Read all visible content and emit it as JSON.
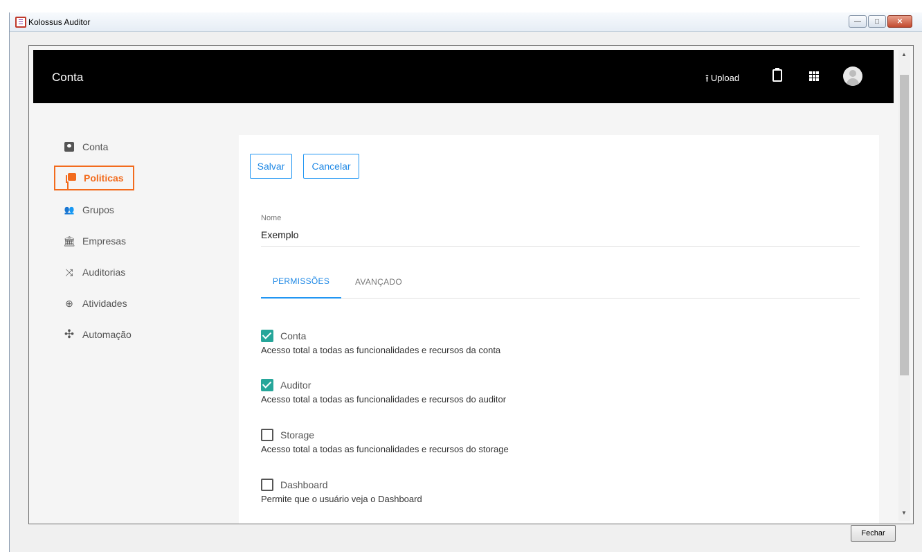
{
  "window": {
    "title": "Kolossus Auditor",
    "minimize_glyph": "—",
    "maximize_glyph": "□",
    "close_glyph": "✕"
  },
  "appbar": {
    "title": "Conta",
    "upload_label": "Upload",
    "upload_icon": "upload-icon",
    "clipboard_icon": "clipboard-icon",
    "apps_icon": "apps-grid-icon",
    "avatar_icon": "account-avatar-icon"
  },
  "sidebar": {
    "items": [
      {
        "label": "Conta",
        "icon": "account-box-icon",
        "glyph": "",
        "active": false
      },
      {
        "label": "Politicas",
        "icon": "library-books-icon",
        "glyph": "",
        "active": true
      },
      {
        "label": "Grupos",
        "icon": "people-icon",
        "glyph": "👥",
        "active": false
      },
      {
        "label": "Empresas",
        "icon": "bank-icon",
        "glyph": "🏛",
        "active": false
      },
      {
        "label": "Auditorias",
        "icon": "shuffle-icon",
        "glyph": "⤨",
        "active": false
      },
      {
        "label": "Atividades",
        "icon": "search-zoom-icon",
        "glyph": "⊕",
        "active": false
      },
      {
        "label": "Automação",
        "icon": "fan-icon",
        "glyph": "✣",
        "active": false
      }
    ]
  },
  "form": {
    "save_label": "Salvar",
    "cancel_label": "Cancelar",
    "name_label": "Nome",
    "name_value": "Exemplo"
  },
  "tabs": [
    {
      "label": "PERMISSÕES",
      "active": true
    },
    {
      "label": "AVANÇADO",
      "active": false
    }
  ],
  "permissions": [
    {
      "name": "Conta",
      "desc": "Acesso total a todas as funcionalidades e recursos da conta",
      "checked": true
    },
    {
      "name": "Auditor",
      "desc": "Acesso total a todas as funcionalidades e recursos do auditor",
      "checked": true
    },
    {
      "name": "Storage",
      "desc": "Acesso total a todas as funcionalidades e recursos do storage",
      "checked": false
    },
    {
      "name": "Dashboard",
      "desc": "Permite que o usuário veja o Dashboard",
      "checked": false
    }
  ],
  "footer": {
    "close_label": "Fechar"
  },
  "colors": {
    "accent": "#2196f3",
    "active_nav": "#f26b1d",
    "checkbox_on": "#26a69a",
    "appbar_bg": "#000000"
  }
}
